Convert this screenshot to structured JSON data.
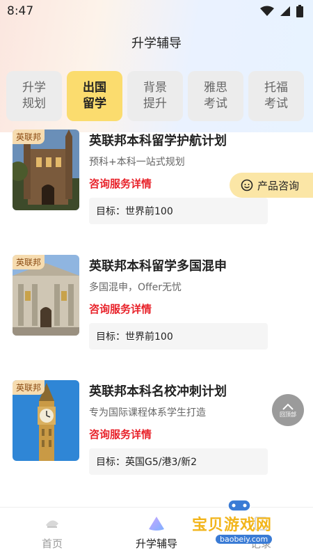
{
  "status": {
    "time": "8:47"
  },
  "header": {
    "title": "升学辅导"
  },
  "tabs": [
    {
      "line1": "升学",
      "line2": "规划"
    },
    {
      "line1": "出国",
      "line2": "留学"
    },
    {
      "line1": "背景",
      "line2": "提升"
    },
    {
      "line1": "雅思",
      "line2": "考试"
    },
    {
      "line1": "托福",
      "line2": "考试"
    }
  ],
  "cards": [
    {
      "badge": "英联邦",
      "title": "英联邦本科留学护航计划",
      "subtitle": "预科+本科一站式规划",
      "link": "咨询服务详情",
      "target": "目标：世界前100"
    },
    {
      "badge": "英联邦",
      "title": "英联邦本科留学多国混申",
      "subtitle": "多国混申，Offer无忧",
      "link": "咨询服务详情",
      "target": "目标：世界前100"
    },
    {
      "badge": "英联邦",
      "title": "英联邦本科名校冲刺计划",
      "subtitle": "专为国际课程体系学生打造",
      "link": "咨询服务详情",
      "target": "目标：英国G5/港3/新2"
    }
  ],
  "consult": {
    "label": "产品咨询"
  },
  "back_top": {
    "label": "回顶部"
  },
  "bottom_nav": [
    {
      "label": "首页"
    },
    {
      "label": "升学辅导"
    },
    {
      "label": "记录"
    }
  ],
  "watermark": {
    "text": "宝贝游戏网",
    "url": "baobeiy.com"
  },
  "colors": {
    "accent": "#fbdc6e",
    "link": "#e8232b",
    "badge": "#f6dcb0"
  }
}
